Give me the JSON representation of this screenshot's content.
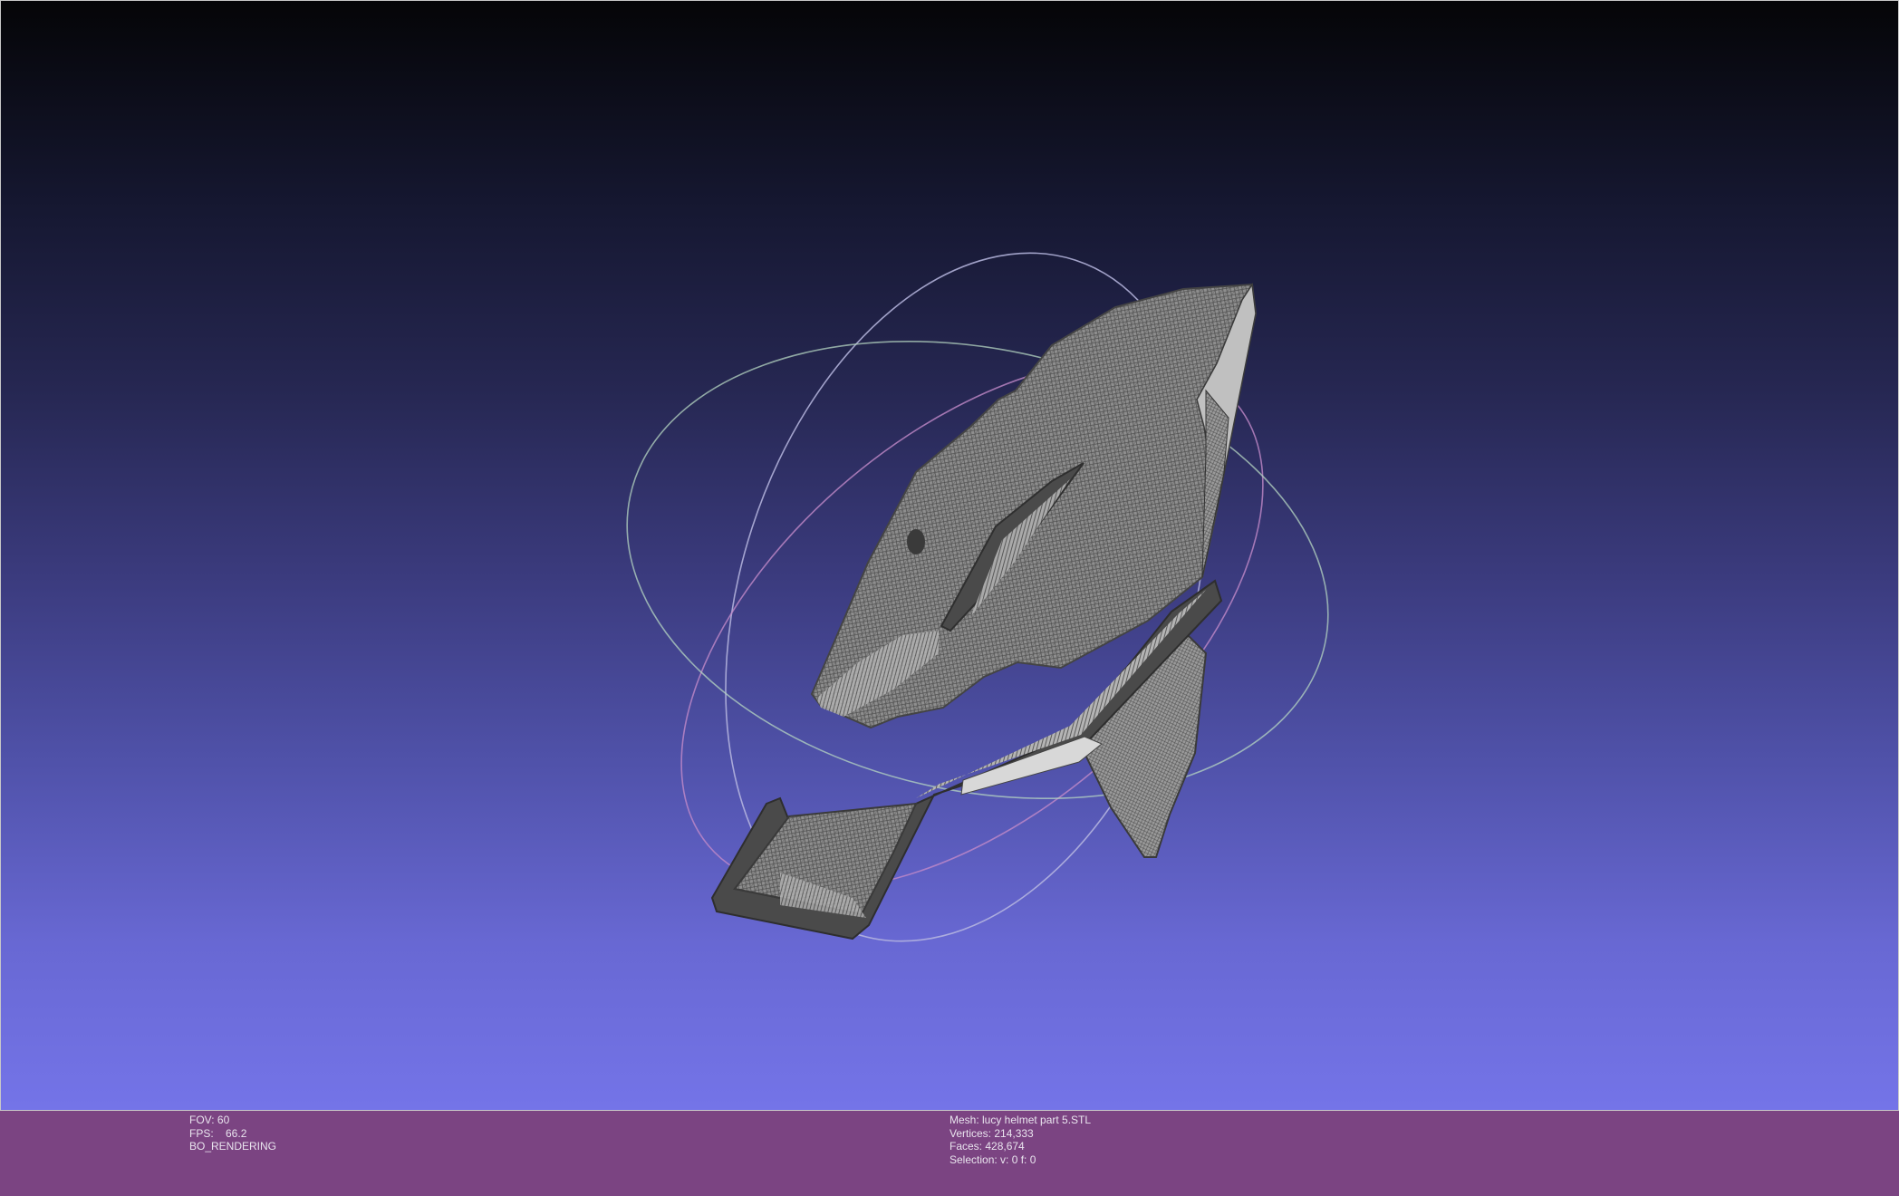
{
  "viewport": {
    "gradient_top": "#050507",
    "gradient_bottom": "#7474e8"
  },
  "mesh_view": {
    "model_color": "#8a8a8a",
    "wire_color": "#3e3e3e",
    "trackball_colors": [
      "#b8b8e0",
      "#c28ac8",
      "#b6d6c2"
    ]
  },
  "info_left": {
    "fov": "FOV: 60",
    "fps": "FPS:    66.2",
    "mode": "BO_RENDERING"
  },
  "info_right": {
    "mesh": "Mesh: lucy helmet part 5.STL",
    "vertices": "Vertices: 214,333",
    "faces": "Faces: 428,674",
    "selection": "Selection: v: 0 f: 0"
  },
  "colors": {
    "infobar_bg": "#7b4482",
    "info_text": "#e9e4ee"
  }
}
